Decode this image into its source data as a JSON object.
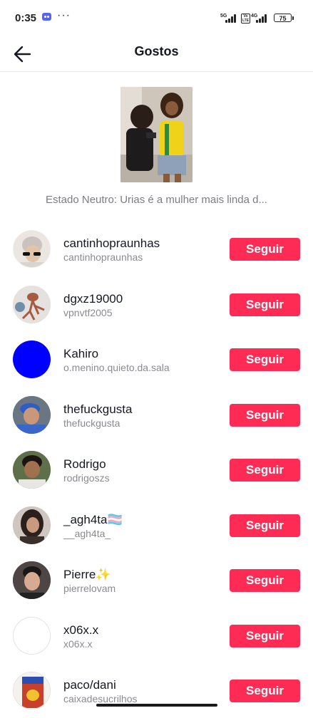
{
  "status_bar": {
    "time": "0:35",
    "dots": "···",
    "net1": "5G",
    "net2": "4G",
    "volte": "Vo LTE",
    "battery": "75"
  },
  "header": {
    "title": "Gostos",
    "back_icon": "back-arrow-icon"
  },
  "video": {
    "caption": "Estado Neutro: Urias é a mulher mais linda d..."
  },
  "users": [
    {
      "display_name": "cantinhopraunhas",
      "username": "cantinhopraunhas",
      "button": "Seguir",
      "avatar_color": "#e6ddd5"
    },
    {
      "display_name": "dgxz19000",
      "username": "vpnvtf2005",
      "button": "Seguir",
      "avatar_color": "#d8d4d2"
    },
    {
      "display_name": "Kahiro",
      "username": "o.menino.quieto.da.sala",
      "button": "Seguir",
      "avatar_color": "#0000ff"
    },
    {
      "display_name": "thefuckgusta",
      "username": "thefuckgusta",
      "button": "Seguir",
      "avatar_color": "#5d6f7c"
    },
    {
      "display_name": "Rodrigo",
      "username": "rodrigoszs",
      "button": "Seguir",
      "avatar_color": "#6b7a55"
    },
    {
      "display_name": "_agh4ta🏳️‍⚧️",
      "username": "__agh4ta_",
      "button": "Seguir",
      "avatar_color": "#b7aba6"
    },
    {
      "display_name": "Pierre✨",
      "username": "pierrelovam",
      "button": "Seguir",
      "avatar_color": "#5a4f4d"
    },
    {
      "display_name": "x06x.x",
      "username": "x06x.x",
      "button": "Seguir",
      "avatar_color": "#ffffff"
    },
    {
      "display_name": "paco/dani",
      "username": "caixadesucrilhos",
      "button": "Seguir",
      "avatar_color": "#c84a2a"
    }
  ],
  "colors": {
    "follow_button": "#fe2c55",
    "secondary_text": "#8a8b91"
  }
}
